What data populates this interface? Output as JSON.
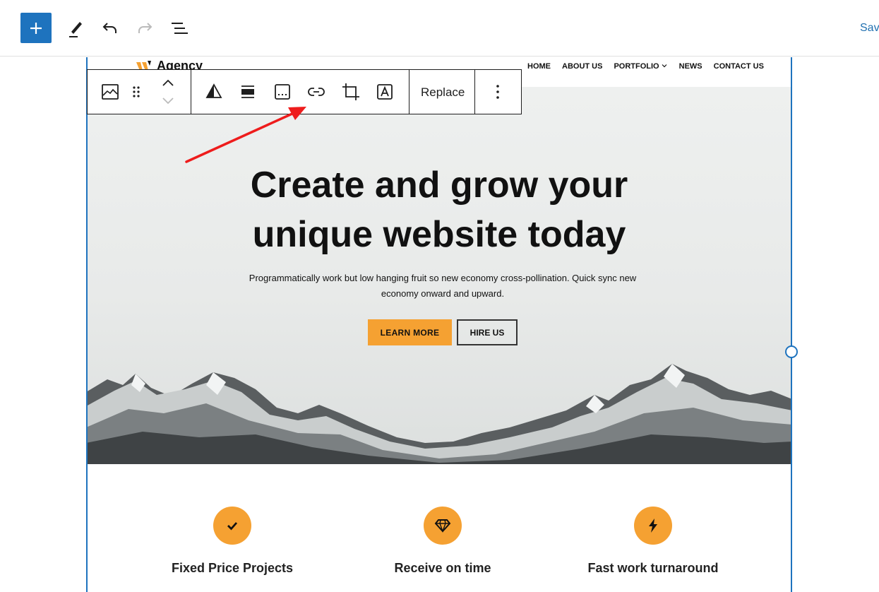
{
  "toolbar": {
    "add_icon": "plus-icon",
    "tools_icon": "pencil-icon",
    "undo_icon": "undo-icon",
    "redo_icon": "redo-icon",
    "list_view_icon": "list-view-icon",
    "save_label": "Sav",
    "accent_color": "#1e73be"
  },
  "block_toolbar": {
    "icons": [
      "image-icon",
      "drag-handle-icon",
      "move-up-down-icon",
      "duotone-icon",
      "align-icon",
      "caption-icon",
      "link-icon",
      "crop-icon",
      "text-overlay-icon",
      "more-options-icon"
    ],
    "replace_label": "Replace"
  },
  "site": {
    "logo_name": "Agency",
    "nav": [
      "HOME",
      "ABOUT US",
      "PORTFOLIO",
      "NEWS",
      "CONTACT US"
    ],
    "hero": {
      "title_line1": "Create and grow your",
      "title_line2": "unique website today",
      "subtitle_line1": "Programmatically work but low hanging fruit so new economy cross-pollination. Quick sync new",
      "subtitle_line2": "economy onward and upward.",
      "primary_button": "LEARN MORE",
      "secondary_button": "HIRE US"
    },
    "features": [
      {
        "icon": "checkmark-icon",
        "title": "Fixed Price Projects"
      },
      {
        "icon": "diamond-icon",
        "title": "Receive on time"
      },
      {
        "icon": "lightning-icon",
        "title": "Fast work turnaround"
      }
    ],
    "brand_color": "#f5a132"
  },
  "annotation": {
    "color": "#ee1c1c",
    "points_to": "link-icon"
  }
}
